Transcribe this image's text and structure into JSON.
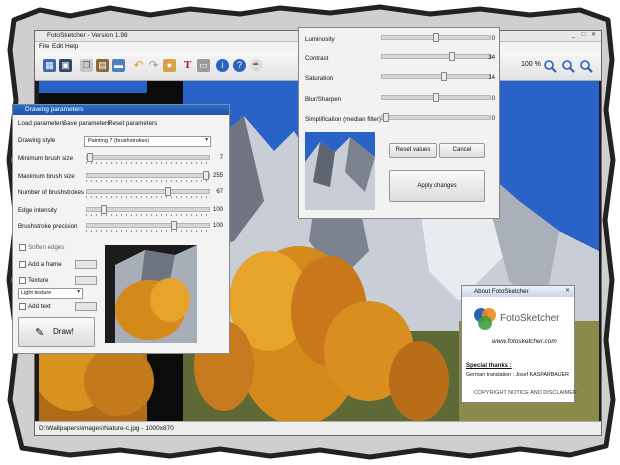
{
  "main_window": {
    "title": "FotoSketcher - Version 1.98",
    "menu": [
      "File",
      "Edit",
      "Help"
    ],
    "zoom": "100 %",
    "status": "D:\\Wallpapers\\images\\Nature-c.jpg - 1000x870",
    "toolbar_icons": [
      "open-icon",
      "save-icon",
      "copy-icon",
      "paste-icon",
      "image-icon",
      "undo-icon",
      "redo-icon",
      "palette-icon",
      "text-icon",
      "print-icon",
      "info-icon",
      "help-icon",
      "coffee-icon"
    ]
  },
  "drawing_params": {
    "title": "Drawing parameters",
    "menu": [
      "Load parameters",
      "Save parameters",
      "Reset parameters"
    ],
    "style_label": "Drawing style",
    "style_value": "Painting 7 (brushstrokes)",
    "sliders": [
      {
        "label": "Minimum brush size",
        "value": "7",
        "pos": 0.02
      },
      {
        "label": "Maximum brush size",
        "value": "255",
        "pos": 1.0
      },
      {
        "label": "Number of brushstrokes",
        "value": "67",
        "pos": 0.65
      },
      {
        "label": "Edge intensity",
        "value": "100",
        "pos": 0.12
      },
      {
        "label": "Brushstroke precision",
        "value": "100",
        "pos": 0.7
      }
    ],
    "soften_edges": "Soften edges",
    "add_frame": "Add a frame",
    "texture": "Texture",
    "texture_value": "Light texture",
    "add_text": "Add text",
    "draw_button": "Draw!"
  },
  "filters": {
    "sliders": [
      {
        "label": "Luminosity",
        "value": "0",
        "pos": 0.5
      },
      {
        "label": "Contrast",
        "value": "34",
        "pos": 0.65
      },
      {
        "label": "Saturation",
        "value": "14",
        "pos": 0.57
      },
      {
        "label": "Blur/Sharpen",
        "value": "0",
        "pos": 0.5
      },
      {
        "label": "Simplification (median filter)",
        "value": "0",
        "pos": 0.02
      }
    ],
    "reset": "Reset values",
    "cancel": "Cancel",
    "apply": "Apply changes"
  },
  "about": {
    "title": "About FotoSketcher",
    "brand": "FotoSketcher",
    "url": "www.fotosketcher.com",
    "thanks": "Special thanks :",
    "credit": "German translation : Josef KASPARBAUER",
    "notice": "COPYRIGHT NOTICE AND DISCLAIMER"
  },
  "colors": {
    "accent": "#2b5fb5",
    "sky": "#2a63c8",
    "autumn": "#d89220"
  }
}
